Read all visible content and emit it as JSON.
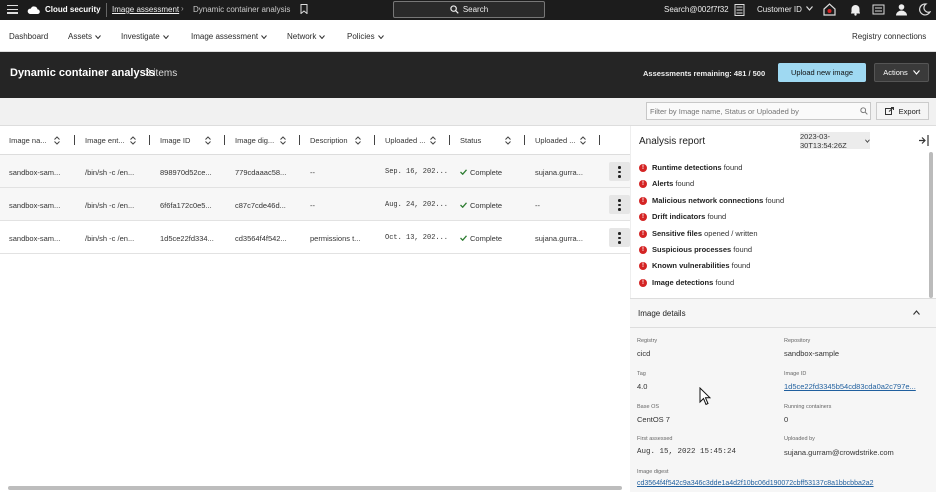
{
  "topbar": {
    "brand": "Cloud security",
    "breadcrumb_parent": "Image assessment",
    "breadcrumb_sep": "›",
    "breadcrumb_current": "Dynamic container analysis",
    "search_label": "Search",
    "tenant": "Search@002f7f32",
    "customer_id_label": "Customer ID"
  },
  "nav": {
    "items": [
      {
        "label": "Dashboard"
      },
      {
        "label": "Assets"
      },
      {
        "label": "Investigate"
      },
      {
        "label": "Image assessment"
      },
      {
        "label": "Network"
      },
      {
        "label": "Policies"
      }
    ],
    "registry_link": "Registry connections"
  },
  "header": {
    "title": "Dynamic container analysis",
    "count": "3 items",
    "assessments_remaining": "Assessments remaining: 481 / 500",
    "upload_button": "Upload new image",
    "actions_button": "Actions"
  },
  "filterbar": {
    "placeholder": "Filter by Image name, Status or Uploaded by",
    "export_button": "Export"
  },
  "table": {
    "columns": [
      "Image na...",
      "Image ent...",
      "Image ID",
      "Image dig...",
      "Description",
      "Uploaded ...",
      "Status",
      "Uploaded ..."
    ],
    "rows": [
      {
        "name": "sandbox-sam...",
        "entry": "/bin/sh -c /en...",
        "id": "898970d52ce...",
        "digest": "779cdaaac58...",
        "description": "--",
        "uploaded": "Sep. 16, 202...",
        "status": "Complete",
        "uploaded_by": "sujana.gurra..."
      },
      {
        "name": "sandbox-sam...",
        "entry": "/bin/sh -c /en...",
        "id": "6f6fa172c0e5...",
        "digest": "c87c7cde46d...",
        "description": "--",
        "uploaded": "Aug. 24, 202...",
        "status": "Complete",
        "uploaded_by": "--"
      },
      {
        "name": "sandbox-sam...",
        "entry": "/bin/sh -c /en...",
        "id": "1d5ce22fd334...",
        "digest": "cd3564f4f542...",
        "description": "permissions t...",
        "uploaded": "Oct. 13, 202...",
        "status": "Complete",
        "uploaded_by": "sujana.gurra..."
      }
    ]
  },
  "analysis": {
    "title": "Analysis report",
    "date": "2023-03-30T13:54:26Z",
    "findings": [
      {
        "bold": "Runtime detections",
        "rest": "found"
      },
      {
        "bold": "Alerts",
        "rest": "found"
      },
      {
        "bold": "Malicious network connections",
        "rest": "found"
      },
      {
        "bold": "Drift indicators",
        "rest": "found"
      },
      {
        "bold": "Sensitive files",
        "rest": "opened / written"
      },
      {
        "bold": "Suspicious processes",
        "rest": "found"
      },
      {
        "bold": "Known vulnerabilities",
        "rest": "found"
      },
      {
        "bold": "Image detections",
        "rest": "found"
      }
    ]
  },
  "details": {
    "title": "Image details",
    "registry_label": "Registry",
    "registry": "cicd",
    "repository_label": "Repository",
    "repository": "sandbox-sample",
    "tag_label": "Tag",
    "tag": "4.0",
    "image_id_label": "Image ID",
    "image_id": "1d5ce22fd3345b54cd83cda0a2c797e...",
    "base_os_label": "Base OS",
    "base_os": "CentOS 7",
    "running_label": "Running containers",
    "running": "0",
    "first_assessed_label": "First assessed",
    "first_assessed": "Aug. 15, 2022 15:45:24",
    "uploaded_by_label": "Uploaded by",
    "uploaded_by": "sujana.gurram@crowdstrike.com",
    "digest_label": "Image digest",
    "digest": "cd3564f4f542c9a346c3dde1a4d2f10bc06d190072cbff53137c8a1bbcbba2a2"
  },
  "colors": {
    "topbar": "#1c1c1c",
    "header": "#252525",
    "accent": "#9fd9f2",
    "error": "#d42424",
    "success": "#2e7d32",
    "link": "#1f5f9e"
  }
}
